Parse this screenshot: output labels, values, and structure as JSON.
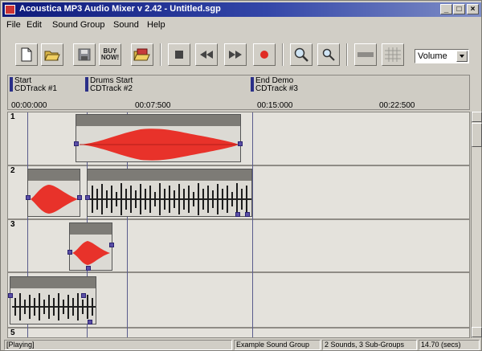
{
  "window": {
    "title": "Acoustica MP3 Audio Mixer v 2.42 - Untitled.sgp",
    "minimize": "_",
    "maximize": "□",
    "close": "×"
  },
  "menu": [
    "File",
    "Edit",
    "Sound Group",
    "Sound",
    "Help"
  ],
  "toolbar": {
    "buy_now_line1": "BUY",
    "buy_now_line2": "NOW!",
    "icons": [
      "new-icon",
      "open-folder-icon",
      "save-disk-icon",
      "buy-now-icon",
      "open-multiple-icon",
      "stop-icon",
      "rewind-icon",
      "fast-forward-icon",
      "record-icon",
      "zoom-in-icon",
      "zoom-out-icon",
      "volume-bar-icon",
      "grid-icon"
    ],
    "volume_select": "Volume"
  },
  "ruler": {
    "markers": [
      {
        "name": "Start",
        "track": "CDTrack #1"
      },
      {
        "name": "Drums Start",
        "track": "CDTrack #2"
      },
      {
        "name": "End Demo",
        "track": "CDTrack #3"
      }
    ],
    "times": [
      "00:00:000",
      "00:07:500",
      "00:15:000",
      "00:22:500"
    ]
  },
  "tracks": {
    "lane_numbers": [
      "1",
      "2",
      "3",
      "4",
      "5"
    ],
    "colors": {
      "red_wave": "#e8322a",
      "dark_wave": "#222222",
      "handle": "#5a4ea6"
    }
  },
  "status": {
    "state": "[Playing]",
    "group": "Example Sound Group",
    "counts": "2 Sounds, 3 Sub-Groups",
    "length": "14.70 (secs)"
  }
}
